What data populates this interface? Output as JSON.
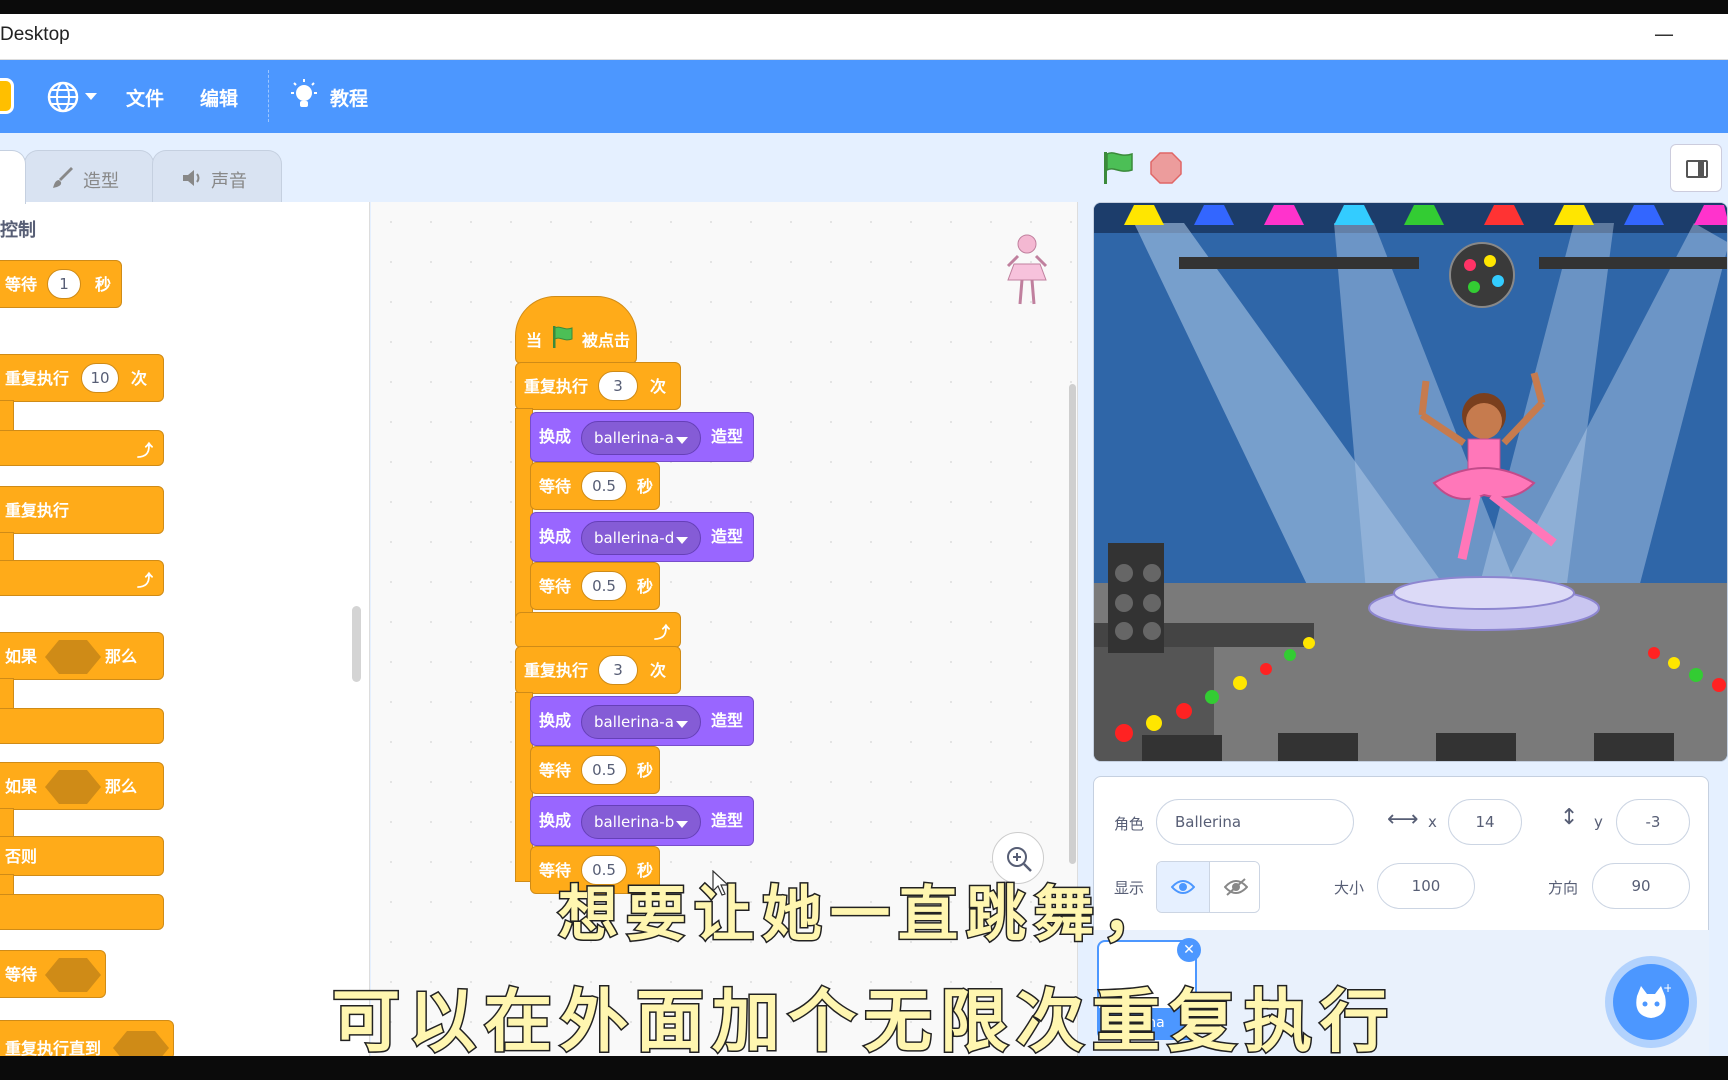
{
  "window": {
    "title": "Desktop",
    "minimize_glyph": "—"
  },
  "menubar": {
    "items": [
      "文件",
      "编辑",
      "教程"
    ],
    "icons": [
      "scratch-logo-icon",
      "globe-icon",
      "lightbulb-icon"
    ]
  },
  "tabs": [
    {
      "label": "造型",
      "icon": "brush-icon"
    },
    {
      "label": "声音",
      "icon": "speaker-icon"
    }
  ],
  "palette": {
    "category": "控制",
    "blocks": {
      "wait": {
        "label": "等待",
        "value": "1",
        "unit": "秒"
      },
      "repeat": {
        "label": "重复执行",
        "value": "10",
        "unit": "次"
      },
      "forever": {
        "label": "重复执行"
      },
      "if_then": {
        "label": "如果",
        "then": "那么"
      },
      "if_else": {
        "label": "如果",
        "then": "那么",
        "else": "否则"
      },
      "wait_until": {
        "label": "等待"
      },
      "repeat_until": {
        "label": "重复执行直到"
      }
    }
  },
  "script": {
    "hat": {
      "when": "当",
      "clicked": "被点击"
    },
    "loops": [
      {
        "label": "重复执行",
        "count": "3",
        "unit": "次",
        "steps": [
          {
            "switch": "换成",
            "costume": "ballerina-a",
            "suffix": "造型"
          },
          {
            "wait": "等待",
            "secs": "0.5",
            "unit": "秒"
          },
          {
            "switch": "换成",
            "costume": "ballerina-d",
            "suffix": "造型"
          },
          {
            "wait": "等待",
            "secs": "0.5",
            "unit": "秒"
          }
        ]
      },
      {
        "label": "重复执行",
        "count": "3",
        "unit": "次",
        "steps": [
          {
            "switch": "换成",
            "costume": "ballerina-a",
            "suffix": "造型"
          },
          {
            "wait": "等待",
            "secs": "0.5",
            "unit": "秒"
          },
          {
            "switch": "换成",
            "costume": "ballerina-b",
            "suffix": "造型"
          },
          {
            "wait": "等待",
            "secs": "0.5",
            "unit": "秒"
          }
        ]
      }
    ]
  },
  "sprite_info": {
    "sprite_label": "角色",
    "sprite_name": "Ballerina",
    "x_label": "x",
    "x_value": "14",
    "y_label": "y",
    "y_value": "-3",
    "show_label": "显示",
    "size_label": "大小",
    "size_value": "100",
    "direction_label": "方向",
    "direction_value": "90",
    "sprite_thumb_label": "erina"
  },
  "subtitles": {
    "line1": "想要让她一直跳舞，",
    "line2": "可以在外面加个无限次重复执行"
  },
  "colors": {
    "menubar": "#4c97ff",
    "control": "#ffab19",
    "looks": "#9966ff",
    "subtitle_fill": "#fff6b0"
  }
}
